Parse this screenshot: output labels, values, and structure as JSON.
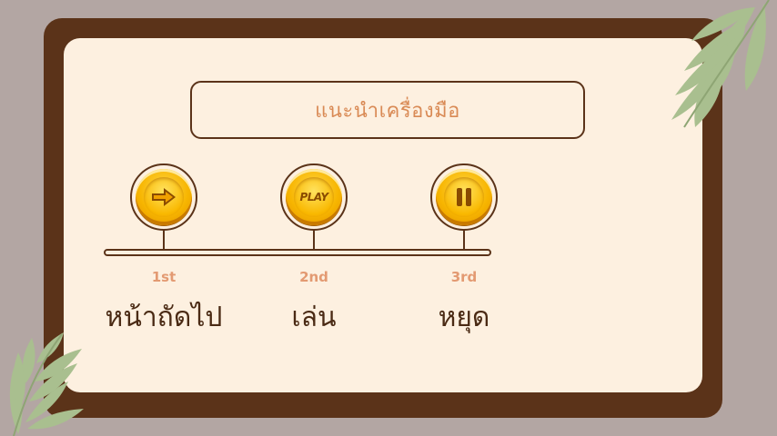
{
  "title": "แนะนำเครื่องมือ",
  "steps": [
    {
      "number": "1st",
      "label": "หน้าถัดไป",
      "icon": "arrow-right-icon"
    },
    {
      "number": "2nd",
      "label": "เล่น",
      "icon": "play-icon",
      "icon_text": "PLAY"
    },
    {
      "number": "3rd",
      "label": "หยุด",
      "icon": "pause-icon"
    }
  ],
  "colors": {
    "background": "#b3a6a3",
    "frame": "#5b3319",
    "card": "#fdf0e0",
    "accent": "#e39a72",
    "coin": "#f7b500",
    "leaf": "#a9bf8f"
  }
}
